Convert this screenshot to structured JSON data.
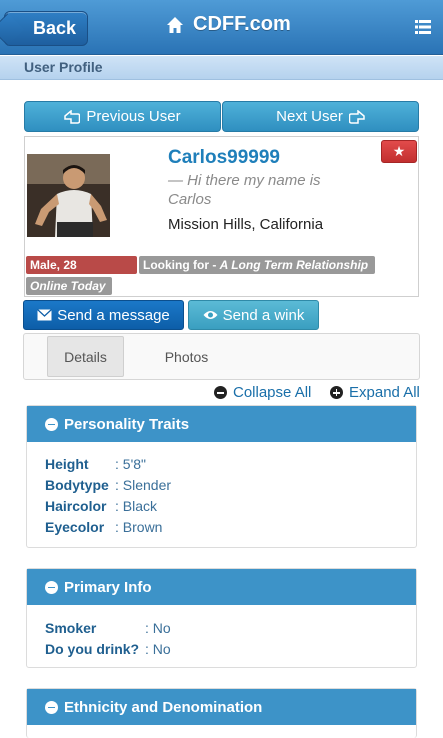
{
  "header": {
    "back_label": "Back",
    "title": "CDFF.com",
    "subheader": "User Profile"
  },
  "nav": {
    "prev_label": "Previous User",
    "next_label": "Next User"
  },
  "profile": {
    "username": "Carlos99999",
    "tagline": "— Hi there my name is Carlos",
    "location": "Mission Hills, California",
    "gender_age": "Male, 28",
    "looking_for_prefix": "Looking for - ",
    "looking_for_value": "A Long Term Relationship",
    "online_status": "Online Today"
  },
  "actions": {
    "message_label": "Send a message",
    "wink_label": "Send a wink"
  },
  "tabs": {
    "details": "Details",
    "photos": "Photos"
  },
  "controls": {
    "collapse_all": "Collapse All",
    "expand_all": "Expand All"
  },
  "sections": {
    "traits": {
      "title": "Personality Traits",
      "rows": [
        {
          "key": "Height",
          "value": ": 5'8\""
        },
        {
          "key": "Bodytype",
          "value": ": Slender"
        },
        {
          "key": "Haircolor",
          "value": ": Black"
        },
        {
          "key": "Eyecolor",
          "value": ": Brown"
        }
      ]
    },
    "primary": {
      "title": "Primary Info",
      "rows": [
        {
          "key": "Smoker",
          "value": ": No"
        },
        {
          "key": "Do you drink?",
          "value": ": No"
        }
      ]
    },
    "ethnicity": {
      "title": "Ethnicity and Denomination"
    }
  },
  "colors": {
    "header_blue": "#2a73b5",
    "section_blue": "#3d93c8",
    "username_blue": "#1f7fba",
    "badge_red": "#b94a48",
    "badge_gray": "#999999"
  },
  "icons": [
    "home-icon",
    "menu-icon",
    "previous-hand-icon",
    "next-hand-icon",
    "star-icon",
    "envelope-icon",
    "eye-icon",
    "minus-circle-icon",
    "plus-circle-icon"
  ]
}
